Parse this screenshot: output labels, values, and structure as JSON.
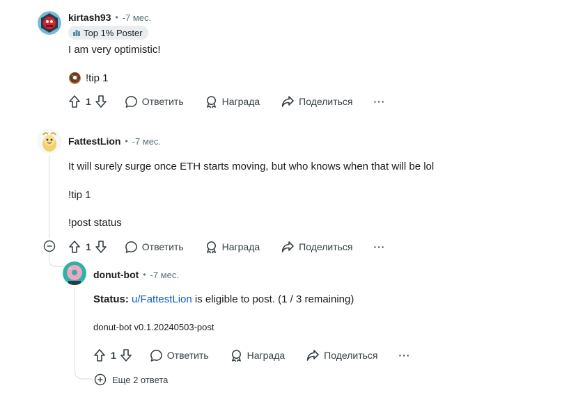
{
  "comments": [
    {
      "username": "kirtash93",
      "separator": "•",
      "time": "-7 мес.",
      "badge": "Top 1% Poster",
      "lines": [
        "I am very optimistic!",
        "!tip 1"
      ],
      "votes": "1"
    },
    {
      "username": "FattestLion",
      "separator": "•",
      "time": "-7 мес.",
      "lines": [
        "It will surely surge once ETH starts moving, but who knows when that will be lol",
        "!tip 1",
        "!post status"
      ],
      "votes": "1"
    },
    {
      "username": "donut-bot",
      "separator": "•",
      "time": "-7 мес.",
      "status_label": "Status",
      "status_colon": ":",
      "status_link": "u/FattestLion",
      "status_rest": " is eligible to post. (1 / 3 remaining)",
      "version": "donut-bot v0.1.20240503-post",
      "votes": "1"
    }
  ],
  "actions": {
    "reply": "Ответить",
    "award": "Награда",
    "share": "Поделиться",
    "more": "···"
  },
  "more_replies": "Еще 2 ответа",
  "colors": {
    "link": "#0a5fc2",
    "meta": "#576f76",
    "thread_line": "#d7dadc",
    "badge_bg": "#eaedef"
  }
}
